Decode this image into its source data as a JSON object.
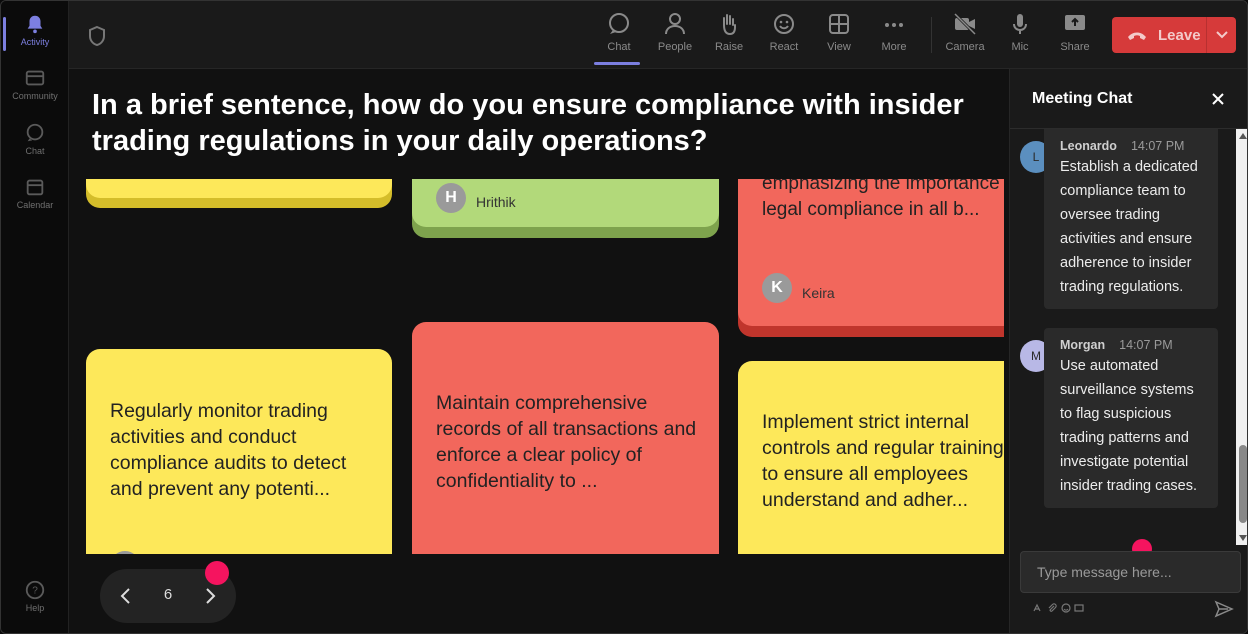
{
  "rail": {
    "items": [
      {
        "label": "Activity"
      },
      {
        "label": "Community"
      },
      {
        "label": "Chat"
      },
      {
        "label": "Calendar"
      },
      {
        "label": "Help"
      }
    ]
  },
  "toolbar": {
    "buttons": [
      {
        "label": "Chat",
        "icon": "chat-icon"
      },
      {
        "label": "People",
        "icon": "people-icon"
      },
      {
        "label": "Raise",
        "icon": "raise-hand-icon"
      },
      {
        "label": "React",
        "icon": "react-icon"
      },
      {
        "label": "View",
        "icon": "view-icon"
      },
      {
        "label": "More",
        "icon": "more-icon"
      },
      {
        "label": "Camera",
        "icon": "camera-off-icon"
      },
      {
        "label": "Mic",
        "icon": "mic-icon"
      },
      {
        "label": "Share",
        "icon": "share-icon"
      }
    ],
    "leave_label": "Leave",
    "leave_color": "#d63a3a",
    "accent": "#7c7fe0"
  },
  "main": {
    "question": "In a brief sentence, how do you ensure compliance with insider trading regulations in your daily operations?",
    "notes": {
      "n2_author": "Hrithik",
      "n2_initial": "H",
      "n3_text": "emphasizing the importance of legal compliance in all b...",
      "n3_author": "Keira",
      "n3_initial": "K",
      "n4_text": "Regularly monitor trading activities and conduct compliance audits to detect and prevent any potenti...",
      "n5_text": "Maintain comprehensive records of all transactions and enforce a clear policy of confidentiality to ...",
      "n6_text": "Implement strict internal controls and regular training to ensure all employees understand and adher..."
    },
    "pager": {
      "page": "6"
    }
  },
  "chat": {
    "title": "Meeting Chat",
    "messages": [
      {
        "initial": "L",
        "author": "Leonardo",
        "time": "14:07 PM",
        "text": "Establish a dedicated compliance team to oversee trading activities and ensure adherence to insider trading regulations.",
        "color": "#5b8fbf"
      },
      {
        "initial": "M",
        "author": "Morgan",
        "time": "14:07 PM",
        "text": "Use automated surveillance systems to flag suspicious trading patterns and investigate potential insider trading cases.",
        "color": "#b8b8e6"
      }
    ],
    "input_placeholder": "Type message here..."
  }
}
